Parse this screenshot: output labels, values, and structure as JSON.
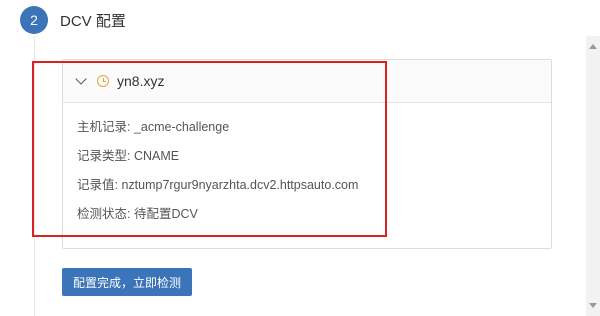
{
  "step": {
    "number": "2",
    "title": "DCV 配置"
  },
  "panel": {
    "domain": "yn8.xyz",
    "status_color": "#e6a23c",
    "rows": [
      {
        "label": "主机记录: ",
        "value": "_acme-challenge"
      },
      {
        "label": "记录类型: ",
        "value": "CNAME"
      },
      {
        "label": "记录值: ",
        "value": "nztump7rgur9nyarzhta.dcv2.httpsauto.com"
      },
      {
        "label": "检测状态: ",
        "value": "待配置DCV"
      }
    ]
  },
  "actions": {
    "check_label": "配置完成，立即检测"
  },
  "colors": {
    "accent": "#3b74b8",
    "highlight": "#e02020"
  }
}
